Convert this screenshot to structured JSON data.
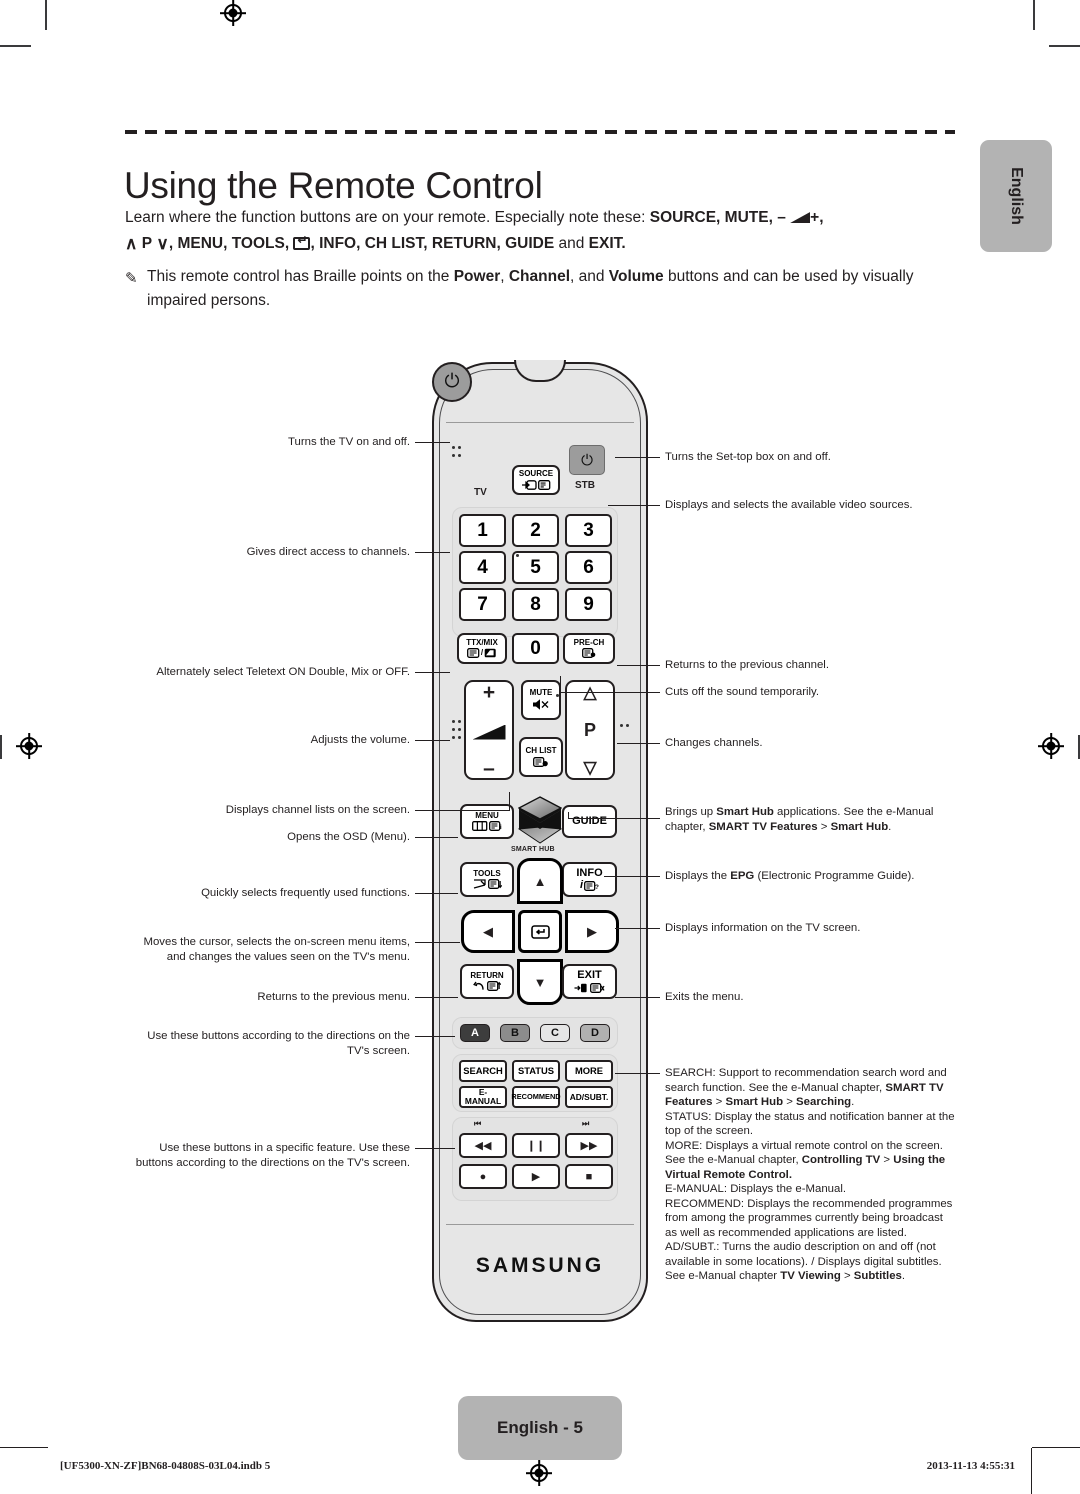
{
  "page": {
    "title": "Using the Remote Control",
    "side_tab": "English",
    "page_badge": "English - 5",
    "footer_left": "[UF5300-XN-ZF]BN68-04808S-03L04.indb   5",
    "footer_right": "2013-11-13   4:55:31",
    "footer_right_glyph": "time-icon"
  },
  "intro": {
    "line1_a": "Learn where the function buttons are on your remote. Especially note these: ",
    "line1_b": "SOURCE, MUTE,",
    "line1_minus": "–",
    "line1_plus": "+,",
    "line2_chev_up": "∧",
    "line2_p": "P",
    "line2_chev_dn": "∨",
    "line2_a": ", MENU, TOOLS, ",
    "line2_b": ", INFO, CH LIST, RETURN, GUIDE",
    "line2_c": " and ",
    "line2_d": "EXIT.",
    "note_icon": "pencil-note-icon",
    "note_a": "This remote control has Braille points on the ",
    "note_power": "Power",
    "note_comma1": ", ",
    "note_channel": "Channel",
    "note_and": ", and ",
    "note_volume": "Volume",
    "note_b": " buttons and can be used by visually impaired persons."
  },
  "remote": {
    "brand": "SAMSUNG",
    "power_tv_icon": "⏻",
    "power_tv_label": "TV",
    "power_stb_icon": "⏻",
    "power_stb_label": "STB",
    "source_label": "SOURCE",
    "numbers": [
      "1",
      "2",
      "3",
      "4",
      "5",
      "6",
      "7",
      "8",
      "9"
    ],
    "zero": "0",
    "ttx_label": "TTX/MIX",
    "prech_label": "PRE-CH",
    "volume_plus": "+",
    "volume_minus": "–",
    "mute_label": "MUTE",
    "chlist_label": "CH LIST",
    "channel_p": "P",
    "menu_label": "MENU",
    "guide_label": "GUIDE",
    "smarthub_label": "SMART HUB",
    "tools_label": "TOOLS",
    "info_label": "INFO",
    "return_label": "RETURN",
    "exit_label": "EXIT",
    "color_buttons": [
      "A",
      "B",
      "C",
      "D"
    ],
    "function_buttons": [
      "SEARCH",
      "STATUS",
      "MORE",
      "E-MANUAL",
      "RECOMMEND",
      "AD/SUBT."
    ],
    "media": {
      "skip_prev": "⏮",
      "skip_next": "⏭",
      "rewind": "◀◀",
      "pause": "❙❙",
      "forward": "▶▶",
      "record": "●",
      "play": "▶",
      "stop": "■"
    }
  },
  "callouts_left": [
    {
      "id": "power-tv",
      "text": "Turns the TV on and off."
    },
    {
      "id": "numbers",
      "text": "Gives direct access to channels."
    },
    {
      "id": "ttx-mix",
      "text": "Alternately select Teletext ON Double, Mix or OFF."
    },
    {
      "id": "volume",
      "text": "Adjusts the volume."
    },
    {
      "id": "ch-list",
      "text": "Displays channel lists on the screen."
    },
    {
      "id": "menu",
      "text": "Opens the OSD (Menu)."
    },
    {
      "id": "tools",
      "text": "Quickly selects frequently used functions."
    },
    {
      "id": "dpad",
      "text": "Moves the cursor, selects the on-screen menu items, and changes the values seen on the TV's menu."
    },
    {
      "id": "return",
      "text": "Returns to the previous menu."
    },
    {
      "id": "colour",
      "text": "Use these buttons according to the directions on the TV's screen."
    },
    {
      "id": "media",
      "text": "Use these buttons in a specific feature. Use these buttons according to the directions on the TV's screen."
    }
  ],
  "callouts_right": [
    {
      "id": "power-stb",
      "text": "Turns the Set-top box on and off."
    },
    {
      "id": "source",
      "text": "Displays and selects the available video sources."
    },
    {
      "id": "pre-ch",
      "text": "Returns to the previous channel."
    },
    {
      "id": "mute",
      "text": "Cuts off the sound temporarily."
    },
    {
      "id": "channel",
      "text": "Changes channels."
    },
    {
      "id": "info",
      "text": "Displays information on the TV screen."
    },
    {
      "id": "exit",
      "text": "Exits the menu."
    }
  ],
  "callouts_rich": {
    "smarthub": {
      "a": "Brings up ",
      "b_bold": "Smart Hub",
      "c": " applications. See the e-Manual chapter, ",
      "d_bold": "SMART TV Features",
      "e": " > ",
      "f_bold": "Smart Hub",
      "g": "."
    },
    "guide": {
      "a": "Displays the ",
      "b_bold": "EPG",
      "c": " (Electronic Programme Guide)."
    },
    "functions": {
      "search_a": "SEARCH: Support to recommendation search word and search function. See the e-Manual chapter, ",
      "search_b_bold": "SMART TV Features",
      "search_c": " > ",
      "search_d_bold": "Smart Hub",
      "search_e": " > ",
      "search_f_bold": "Searching",
      "search_g": ".",
      "status": "STATUS: Display the status and notification banner at the top of the screen.",
      "more_a": "MORE: Displays a virtual remote control on the screen. See the e-Manual chapter, ",
      "more_b_bold": "Controlling TV",
      "more_c": " > ",
      "more_d_bold": "Using the Virtual Remote Control.",
      "emanual": "E-MANUAL: Displays the e-Manual.",
      "recommend": "RECOMMEND: Displays the recommended programmes from among the programmes currently being broadcast as well as recommended applications are listed.",
      "adsubt_a": "AD/SUBT.: Turns the audio description on and off (not available in some locations). / Displays digital subtitles. See e-Manual chapter ",
      "adsubt_b_bold": "TV Viewing",
      "adsubt_c": " > ",
      "adsubt_d_bold": "Subtitles",
      "adsubt_e": "."
    }
  },
  "colors": {
    "body": "#e6e6e6",
    "section": "#e3e3e3",
    "badge": "#b3b3b3",
    "ink": "#231f20"
  }
}
